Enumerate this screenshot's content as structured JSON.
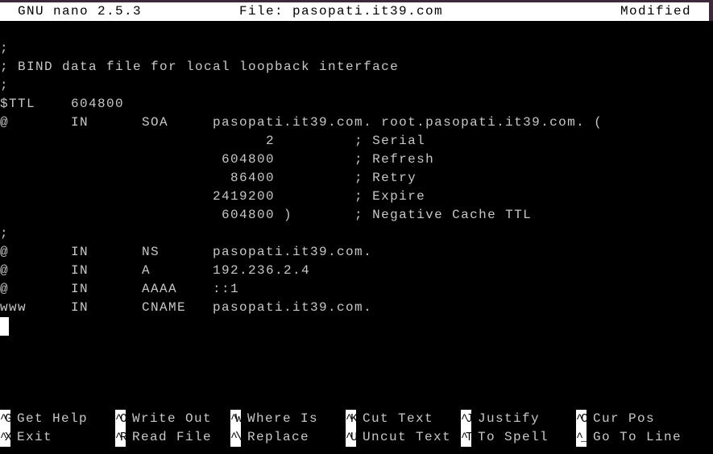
{
  "titlebar": {
    "app": "GNU nano 2.5.3",
    "file": "File: pasopati.it39.com",
    "status": "Modified"
  },
  "lines": [
    "",
    ";",
    "; BIND data file for local loopback interface",
    ";",
    "$TTL    604800",
    "@       IN      SOA     pasopati.it39.com. root.pasopati.it39.com. (",
    "                              2         ; Serial",
    "                         604800         ; Refresh",
    "                          86400         ; Retry",
    "                        2419200         ; Expire",
    "                         604800 )       ; Negative Cache TTL",
    ";",
    "@       IN      NS      pasopati.it39.com.",
    "@       IN      A       192.236.2.4",
    "@       IN      AAAA    ::1",
    "www     IN      CNAME   pasopati.it39.com."
  ],
  "shortcuts": [
    [
      {
        "key": "^G",
        "label": "Get Help"
      },
      {
        "key": "^O",
        "label": "Write Out"
      },
      {
        "key": "^W",
        "label": "Where Is"
      },
      {
        "key": "^K",
        "label": "Cut Text"
      },
      {
        "key": "^J",
        "label": "Justify"
      },
      {
        "key": "^C",
        "label": "Cur Pos"
      }
    ],
    [
      {
        "key": "^X",
        "label": "Exit"
      },
      {
        "key": "^R",
        "label": "Read File"
      },
      {
        "key": "^\\",
        "label": "Replace"
      },
      {
        "key": "^U",
        "label": "Uncut Text"
      },
      {
        "key": "^T",
        "label": "To Spell"
      },
      {
        "key": "^_",
        "label": "Go To Line"
      }
    ]
  ]
}
